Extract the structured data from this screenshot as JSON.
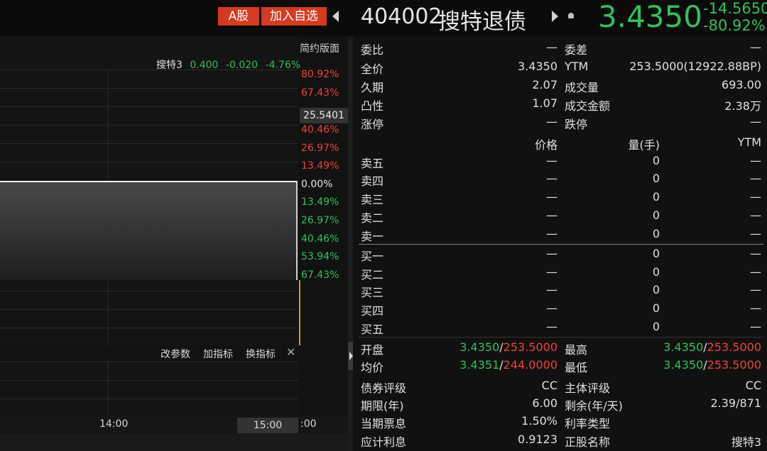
{
  "header": {
    "market_tag": "A股",
    "add_watch": "加入自选",
    "code": "404002",
    "name": "搜特退债",
    "price": "3.4350",
    "change": "-14.5650",
    "change_pct": "-80.92%"
  },
  "chart": {
    "simple_view": "简约版面",
    "legend_name": "搜特3",
    "legend_price": "0.400",
    "legend_change": "-0.020",
    "legend_pct": "-4.76%",
    "price_marker": "25.5401",
    "pct_labels_red": [
      "80.92%",
      "67.43%",
      "40.46%",
      "26.97%",
      "13.49%"
    ],
    "pct_zero": "0.00%",
    "pct_labels_green": [
      "13.49%",
      "26.97%",
      "40.46%",
      "53.94%",
      "67.43%"
    ],
    "tools": [
      "改参数",
      "加指标",
      "换指标"
    ],
    "close_icon": "✕",
    "time_labels": [
      "14:00",
      "15:00",
      ":00"
    ]
  },
  "panel": {
    "weibi_label": "委比",
    "weibi_val": "—",
    "weicha_label": "委差",
    "weicha_val": "—",
    "full_price_label": "全价",
    "full_price_val": "3.4350",
    "ytm_label": "YTM",
    "ytm_val": "253.5000(12922.88BP)",
    "duration_label": "久期",
    "duration_val": "2.07",
    "volume_label": "成交量",
    "volume_val": "693.00",
    "convexity_label": "凸性",
    "convexity_val": "1.07",
    "amount_label": "成交金额",
    "amount_val": "2.38万",
    "limit_up_label": "涨停",
    "limit_up_val": "—",
    "limit_down_label": "跌停",
    "limit_down_val": "—",
    "col_price": "价格",
    "col_qty": "量(手)",
    "col_ytm": "YTM",
    "sell_rows": [
      {
        "label": "卖五",
        "price": "—",
        "qty": "0",
        "ytm": "—"
      },
      {
        "label": "卖四",
        "price": "—",
        "qty": "0",
        "ytm": "—"
      },
      {
        "label": "卖三",
        "price": "—",
        "qty": "0",
        "ytm": "—"
      },
      {
        "label": "卖二",
        "price": "—",
        "qty": "0",
        "ytm": "—"
      },
      {
        "label": "卖一",
        "price": "—",
        "qty": "0",
        "ytm": "—"
      }
    ],
    "buy_rows": [
      {
        "label": "买一",
        "price": "—",
        "qty": "0",
        "ytm": "—"
      },
      {
        "label": "买二",
        "price": "—",
        "qty": "0",
        "ytm": "—"
      },
      {
        "label": "买三",
        "price": "—",
        "qty": "0",
        "ytm": "—"
      },
      {
        "label": "买四",
        "price": "—",
        "qty": "0",
        "ytm": "—"
      },
      {
        "label": "买五",
        "price": "—",
        "qty": "0",
        "ytm": "—"
      }
    ],
    "open_label": "开盘",
    "open_price": "3.4350",
    "open_ytm": "253.5000",
    "high_label": "最高",
    "high_price": "3.4350",
    "high_ytm": "253.5000",
    "avg_label": "均价",
    "avg_price": "3.4351",
    "avg_ytm": "244.0000",
    "low_label": "最低",
    "low_price": "3.4350",
    "low_ytm": "253.5000",
    "slash": "/",
    "rating_label": "债券评级",
    "rating_val": "CC",
    "issuer_rating_label": "主体评级",
    "issuer_rating_val": "CC",
    "term_label": "期限(年)",
    "term_val": "6.00",
    "remain_label": "剩余(年/天)",
    "remain_val": "2.39/871",
    "coupon_label": "当期票息",
    "coupon_val": "1.50%",
    "rate_type_label": "利率类型",
    "rate_type_val": "",
    "accrued_label": "应计利息",
    "accrued_val": "0.9123",
    "stock_name_label": "正股名称",
    "stock_name_val": "搜特3"
  }
}
